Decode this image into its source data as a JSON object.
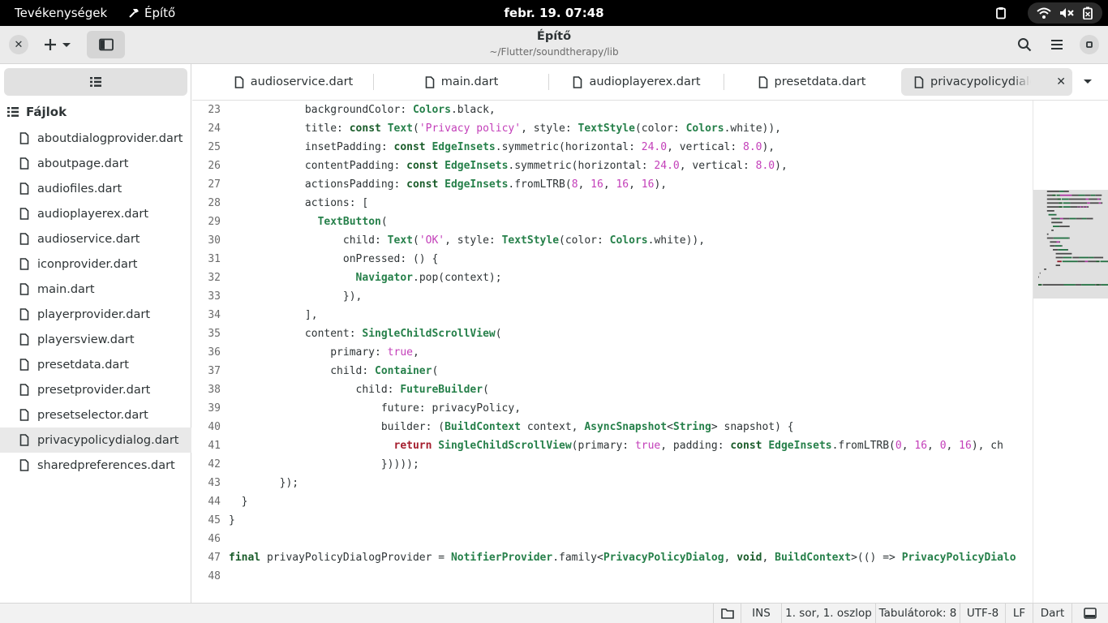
{
  "topbar": {
    "activities": "Tevékenységek",
    "app_name": "Építő",
    "clock": "febr. 19.  07:48",
    "tray_icons": [
      "clipboard-icon",
      "wifi-icon",
      "volume-muted-icon",
      "battery-icon"
    ]
  },
  "headerbar": {
    "title": "Építő",
    "subtitle": "~/Flutter/soundtherapy/lib",
    "buttons": [
      "close-icon",
      "plus-icon",
      "chevron-down-icon",
      "sidebar-icon",
      "search-icon",
      "menu-icon",
      "minimize-icon"
    ]
  },
  "sidebar": {
    "header": "Fájlok",
    "files": [
      {
        "label": "aboutdialogprovider.dart"
      },
      {
        "label": "aboutpage.dart"
      },
      {
        "label": "audiofiles.dart"
      },
      {
        "label": "audioplayerex.dart"
      },
      {
        "label": "audioservice.dart"
      },
      {
        "label": "iconprovider.dart"
      },
      {
        "label": "main.dart"
      },
      {
        "label": "playerprovider.dart"
      },
      {
        "label": "playersview.dart"
      },
      {
        "label": "presetdata.dart"
      },
      {
        "label": "presetprovider.dart"
      },
      {
        "label": "presetselector.dart"
      },
      {
        "label": "privacypolicydialog.dart",
        "selected": true
      },
      {
        "label": "sharedpreferences.dart"
      }
    ]
  },
  "tabs": [
    {
      "label": "audioservice.dart"
    },
    {
      "label": "main.dart"
    },
    {
      "label": "audioplayerex.dart"
    },
    {
      "label": "presetdata.dart"
    },
    {
      "label": "privacypolicydialog.dart",
      "active": true
    }
  ],
  "editor": {
    "language": "Dart",
    "lines": [
      {
        "n": "23",
        "code": [
          [
            "",
            "            backgroundColor: "
          ],
          [
            "ty",
            "Colors"
          ],
          [
            "",
            ".black,"
          ]
        ]
      },
      {
        "n": "24",
        "code": [
          [
            "",
            "            title: "
          ],
          [
            "kw",
            "const"
          ],
          [
            "",
            " "
          ],
          [
            "ty",
            "Text"
          ],
          [
            "",
            "("
          ],
          [
            "str",
            "'Privacy policy'"
          ],
          [
            "",
            ", style: "
          ],
          [
            "ty",
            "TextStyle"
          ],
          [
            "",
            "(color: "
          ],
          [
            "ty",
            "Colors"
          ],
          [
            "",
            ".white)),"
          ]
        ]
      },
      {
        "n": "25",
        "code": [
          [
            "",
            "            insetPadding: "
          ],
          [
            "kw",
            "const"
          ],
          [
            "",
            " "
          ],
          [
            "ty",
            "EdgeInsets"
          ],
          [
            "",
            ".symmetric(horizontal: "
          ],
          [
            "num",
            "24.0"
          ],
          [
            "",
            ", vertical: "
          ],
          [
            "num",
            "8.0"
          ],
          [
            "",
            "),"
          ]
        ]
      },
      {
        "n": "26",
        "code": [
          [
            "",
            "            contentPadding: "
          ],
          [
            "kw",
            "const"
          ],
          [
            "",
            " "
          ],
          [
            "ty",
            "EdgeInsets"
          ],
          [
            "",
            ".symmetric(horizontal: "
          ],
          [
            "num",
            "24.0"
          ],
          [
            "",
            ", vertical: "
          ],
          [
            "num",
            "8.0"
          ],
          [
            "",
            "),"
          ]
        ]
      },
      {
        "n": "27",
        "code": [
          [
            "",
            "            actionsPadding: "
          ],
          [
            "kw",
            "const"
          ],
          [
            "",
            " "
          ],
          [
            "ty",
            "EdgeInsets"
          ],
          [
            "",
            ".fromLTRB("
          ],
          [
            "num",
            "8"
          ],
          [
            "",
            ", "
          ],
          [
            "num",
            "16"
          ],
          [
            "",
            ", "
          ],
          [
            "num",
            "16"
          ],
          [
            "",
            ", "
          ],
          [
            "num",
            "16"
          ],
          [
            "",
            "),"
          ]
        ]
      },
      {
        "n": "28",
        "code": [
          [
            "",
            "            actions: ["
          ]
        ]
      },
      {
        "n": "29",
        "code": [
          [
            "",
            "              "
          ],
          [
            "ty",
            "TextButton"
          ],
          [
            "",
            "("
          ]
        ]
      },
      {
        "n": "30",
        "code": [
          [
            "",
            "                  child: "
          ],
          [
            "ty",
            "Text"
          ],
          [
            "",
            "("
          ],
          [
            "str",
            "'OK'"
          ],
          [
            "",
            ", style: "
          ],
          [
            "ty",
            "TextStyle"
          ],
          [
            "",
            "(color: "
          ],
          [
            "ty",
            "Colors"
          ],
          [
            "",
            ".white)),"
          ]
        ]
      },
      {
        "n": "31",
        "code": [
          [
            "",
            "                  onPressed: () {"
          ]
        ]
      },
      {
        "n": "32",
        "code": [
          [
            "",
            "                    "
          ],
          [
            "ty",
            "Navigator"
          ],
          [
            "",
            ".pop(context);"
          ]
        ]
      },
      {
        "n": "33",
        "code": [
          [
            "",
            "                  }),"
          ]
        ]
      },
      {
        "n": "34",
        "code": [
          [
            "",
            "            ],"
          ]
        ]
      },
      {
        "n": "35",
        "code": [
          [
            "",
            "            content: "
          ],
          [
            "ty",
            "SingleChildScrollView"
          ],
          [
            "",
            "("
          ]
        ]
      },
      {
        "n": "36",
        "code": [
          [
            "",
            "                primary: "
          ],
          [
            "num",
            "true"
          ],
          [
            "",
            ","
          ]
        ]
      },
      {
        "n": "37",
        "code": [
          [
            "",
            "                child: "
          ],
          [
            "ty",
            "Container"
          ],
          [
            "",
            "("
          ]
        ]
      },
      {
        "n": "38",
        "code": [
          [
            "",
            "                    child: "
          ],
          [
            "ty",
            "FutureBuilder"
          ],
          [
            "",
            "("
          ]
        ]
      },
      {
        "n": "39",
        "code": [
          [
            "",
            "                        future: privacyPolicy,"
          ]
        ]
      },
      {
        "n": "40",
        "code": [
          [
            "",
            "                        builder: ("
          ],
          [
            "ty",
            "BuildContext"
          ],
          [
            "",
            " context, "
          ],
          [
            "ty",
            "AsyncSnapshot"
          ],
          [
            "",
            "<"
          ],
          [
            "ty",
            "String"
          ],
          [
            "",
            "> snapshot) {"
          ]
        ]
      },
      {
        "n": "41",
        "code": [
          [
            "",
            "                          "
          ],
          [
            "ret",
            "return"
          ],
          [
            "",
            " "
          ],
          [
            "ty",
            "SingleChildScrollView"
          ],
          [
            "",
            "(primary: "
          ],
          [
            "num",
            "true"
          ],
          [
            "",
            ", padding: "
          ],
          [
            "kw",
            "const"
          ],
          [
            "",
            " "
          ],
          [
            "ty",
            "EdgeInsets"
          ],
          [
            "",
            ".fromLTRB("
          ],
          [
            "num",
            "0"
          ],
          [
            "",
            ", "
          ],
          [
            "num",
            "16"
          ],
          [
            "",
            ", "
          ],
          [
            "num",
            "0"
          ],
          [
            "",
            ", "
          ],
          [
            "num",
            "16"
          ],
          [
            "",
            "), ch"
          ]
        ]
      },
      {
        "n": "42",
        "code": [
          [
            "",
            "                        }))));"
          ]
        ]
      },
      {
        "n": "43",
        "code": [
          [
            "",
            "        });"
          ]
        ]
      },
      {
        "n": "44",
        "code": [
          [
            "",
            "  }"
          ]
        ]
      },
      {
        "n": "45",
        "code": [
          [
            "",
            "}"
          ]
        ]
      },
      {
        "n": "46",
        "code": [
          [
            "",
            ""
          ]
        ]
      },
      {
        "n": "47",
        "code": [
          [
            "kw",
            "final"
          ],
          [
            "",
            " privayPolicyDialogProvider = "
          ],
          [
            "ty",
            "NotifierProvider"
          ],
          [
            "",
            ".family<"
          ],
          [
            "ty",
            "PrivacyPolicyDialog"
          ],
          [
            "",
            ", "
          ],
          [
            "kw",
            "void"
          ],
          [
            "",
            ", "
          ],
          [
            "ty",
            "BuildContext"
          ],
          [
            "",
            ">(() => "
          ],
          [
            "ty",
            "PrivacyPolicyDialo"
          ]
        ]
      },
      {
        "n": "48",
        "code": [
          [
            "",
            ""
          ]
        ]
      }
    ]
  },
  "statusbar": {
    "insert_mode": "INS",
    "cursor": "1. sor, 1. oszlop",
    "tabs": "Tabulátorok: 8",
    "encoding": "UTF-8",
    "line_ending": "LF",
    "language": "Dart"
  },
  "colors": {
    "topbar_bg": "#000000",
    "headerbar_bg": "#ebebeb",
    "keyword": "#1a5c2a",
    "type": "#26804a",
    "string": "#c33fb9",
    "return": "#a51d2d"
  }
}
